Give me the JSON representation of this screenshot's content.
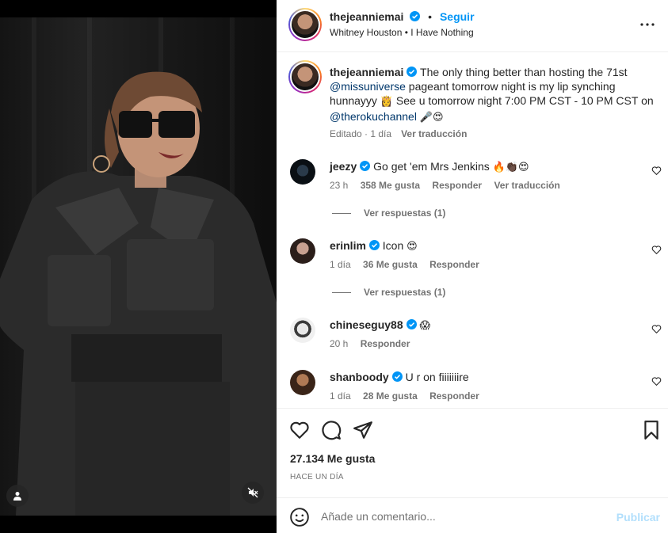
{
  "post": {
    "username": "thejeanniemai",
    "follow_label": "Seguir",
    "separator": "•",
    "song": "Whitney Houston • I Have Nothing"
  },
  "caption": {
    "username": "thejeanniemai",
    "text_1": "The only thing better than hosting the 71st",
    "mention_1": "@missuniverse",
    "text_2": "pageant tomorrow night is my lip synching hunnayyy",
    "emoji_1": "👸",
    "text_3": "See u tomorrow night 7:00 PM CST - 10 PM CST on",
    "mention_2": "@therokuchannel",
    "emoji_2": "🎤😍",
    "meta_time": "Editado · 1 día",
    "meta_translate": "Ver traducción"
  },
  "comments": [
    {
      "username": "jeezy",
      "verified": true,
      "text": "Go get 'em Mrs Jenkins",
      "emoji": "🔥👏🏿😍",
      "time": "23 h",
      "likes": "358 Me gusta",
      "reply": "Responder",
      "translate": "Ver traducción",
      "view_replies": "Ver respuestas (1)"
    },
    {
      "username": "erinlim",
      "verified": true,
      "text": "Icon",
      "emoji": "😍",
      "time": "1 día",
      "likes": "36 Me gusta",
      "reply": "Responder",
      "view_replies": "Ver respuestas (1)"
    },
    {
      "username": "chineseguy88",
      "verified": true,
      "text": "",
      "emoji": "😱",
      "time": "20 h",
      "reply": "Responder"
    },
    {
      "username": "shanboody",
      "verified": true,
      "text": "U r on fiiiiiiire",
      "emoji": "",
      "time": "1 día",
      "likes": "28 Me gusta",
      "reply": "Responder"
    }
  ],
  "likes_count": "27.134 Me gusta",
  "post_time": "HACE UN DÍA",
  "comment_input": {
    "placeholder": "Añade un comentario..."
  },
  "publish_label": "Publicar",
  "colors": {
    "link": "#0095f6",
    "muted": "#737373",
    "mention": "#00376b",
    "publish_disabled": "#b2dffc"
  },
  "icons": [
    "more-icon",
    "heart-icon",
    "comment-icon",
    "share-icon",
    "bookmark-icon",
    "emoji-icon",
    "user-tag-icon",
    "mute-icon",
    "verified-icon"
  ]
}
